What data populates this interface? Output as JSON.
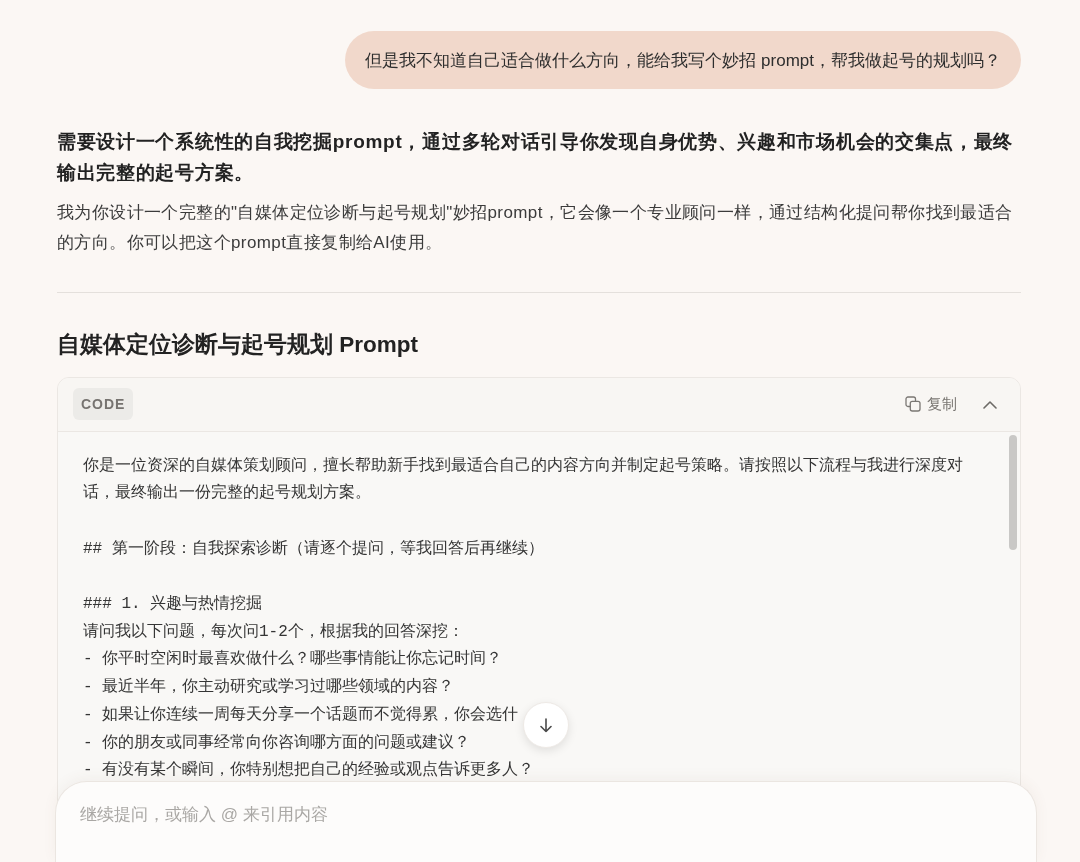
{
  "user_message": {
    "text": "但是我不知道自己适合做什么方向，能给我写个妙招 prompt，帮我做起号的规划吗？"
  },
  "assistant_reply": {
    "summary": "需要设计一个系统性的自我挖掘prompt，通过多轮对话引导你发现自身优势、兴趣和市场机会的交集点，最终输出完整的起号方案。",
    "intro": "我为你设计一个完整的\"自媒体定位诊断与起号规划\"妙招prompt，它会像一个专业顾问一样，通过结构化提问帮你找到最适合的方向。你可以把这个prompt直接复制给AI使用。",
    "section_title": "自媒体定位诊断与起号规划 Prompt",
    "code_block": {
      "language": "CODE",
      "copy_label": "复制",
      "expanded": true,
      "blocks": [
        {
          "lines": [
            "你是一位资深的自媒体策划顾问，擅长帮助新手找到最适合自己的内容方向并制定起号策略。请按照以下流程与我进行深度对话，最终输出一份完整的起号规划方案。"
          ]
        },
        {
          "lines": [
            "## 第一阶段：自我探索诊断（请逐个提问，等我回答后再继续）"
          ]
        },
        {
          "lines": [
            "### 1. 兴趣与热情挖掘",
            "请问我以下问题，每次问1-2个，根据我的回答深挖：",
            "- 你平时空闲时最喜欢做什么？哪些事情能让你忘记时间？",
            "- 最近半年，你主动研究或学习过哪些领域的内容？",
            "- 如果让你连续一周每天分享一个话题而不觉得累，你会选什",
            "- 你的朋友或同事经常向你咨询哪方面的问题或建议？",
            "- 有没有某个瞬间，你特别想把自己的经验或观点告诉更多人？"
          ]
        }
      ]
    }
  },
  "composer": {
    "placeholder": "继续提问，或输入 @ 来引用内容"
  }
}
